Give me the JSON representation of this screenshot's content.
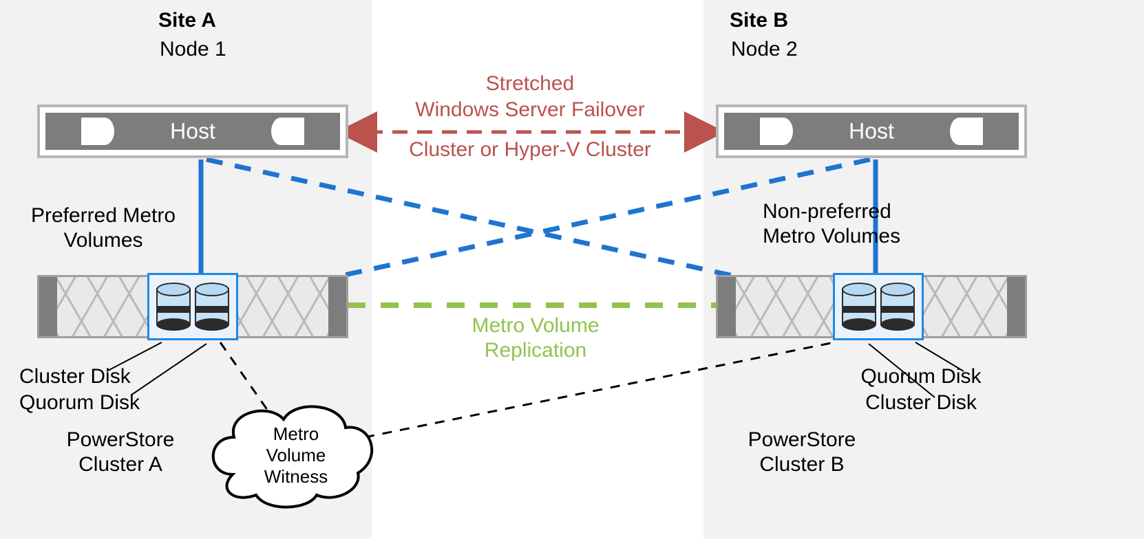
{
  "siteA": {
    "title": "Site A",
    "node": "Node 1",
    "host": "Host",
    "volumes": "Preferred Metro\nVolumes",
    "disk1": "Cluster Disk",
    "disk2": "Quorum Disk",
    "cluster": "PowerStore\nCluster A"
  },
  "siteB": {
    "title": "Site B",
    "node": "Node 2",
    "host": "Host",
    "volumes": "Non-preferred\nMetro Volumes",
    "disk1": "Quorum Disk",
    "disk2": "Cluster Disk",
    "cluster": "PowerStore\nCluster B"
  },
  "center": {
    "stretched_top": "Stretched",
    "stretched_mid": "Windows Server Failover",
    "stretched_bot": "Cluster or Hyper-V Cluster",
    "replication": "Metro Volume\nReplication",
    "witness": "Metro\nVolume\nWitness"
  },
  "colors": {
    "red": "#ba524d",
    "blue": "#1e74d0",
    "green": "#93c24e",
    "black": "#000000"
  }
}
